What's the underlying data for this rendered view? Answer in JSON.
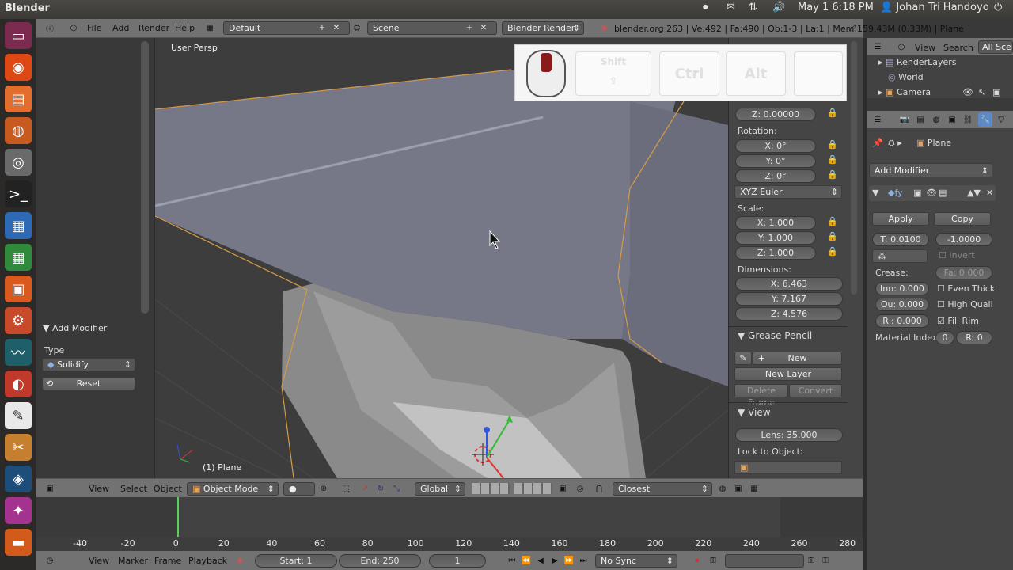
{
  "topbar": {
    "title": "Blender",
    "datetime": "May 1  6:18 PM",
    "user": "Johan Tri Handoyo"
  },
  "header": {
    "menus": [
      "File",
      "Add",
      "Render",
      "Help"
    ],
    "layout": "Default",
    "scene": "Scene",
    "engine": "Blender Render",
    "stats": "blender.org 263 | Ve:492 | Fa:490 | Ob:1-3 | La:1 | Mem:159.43M (0.33M) | Plane"
  },
  "keys": {
    "shift": "Shift",
    "ctrl": "Ctrl",
    "alt": "Alt"
  },
  "viewport": {
    "label": "User Persp",
    "object": "(1) Plane"
  },
  "toolshelf": {
    "title": "Add Modifier",
    "type_label": "Type",
    "type_value": "Solidify",
    "reset": "Reset"
  },
  "npanel": {
    "loc_z": "Z: 0.00000",
    "rotation_label": "Rotation:",
    "rot_x": "X: 0°",
    "rot_y": "Y: 0°",
    "rot_z": "Z: 0°",
    "rot_mode": "XYZ Euler",
    "scale_label": "Scale:",
    "sc_x": "X: 1.000",
    "sc_y": "Y: 1.000",
    "sc_z": "Z: 1.000",
    "dim_label": "Dimensions:",
    "dim_x": "X: 6.463",
    "dim_y": "Y: 7.167",
    "dim_z": "Z: 4.576",
    "grease_title": "Grease Pencil",
    "new": "New",
    "new_layer": "New Layer",
    "delete_frame": "Delete Frame",
    "convert": "Convert",
    "view_title": "View",
    "lens": "Lens: 35.000",
    "lock_label": "Lock to Object:"
  },
  "outliner": {
    "menus": [
      "View",
      "Search"
    ],
    "filter": "All Scene",
    "items": [
      "RenderLayers",
      "World",
      "Camera"
    ]
  },
  "props": {
    "object": "Plane",
    "add_modifier": "Add Modifier",
    "apply": "Apply",
    "copy": "Copy",
    "thickness": "T: 0.0100",
    "offset": "-1.0000",
    "invert": "Invert",
    "crease_label": "Crease:",
    "crease_fa": "Fa: 0.000",
    "inner": "Inn: 0.000",
    "outer": "Ou: 0.000",
    "rim": "Ri: 0.000",
    "even_thick": "Even Thick",
    "high_quality": "High Quali",
    "fill_rim": "Fill Rim",
    "material_label": "Material Index",
    "mat_a": "0",
    "mat_b": "R: 0"
  },
  "v3dheader": {
    "menus": [
      "View",
      "Select",
      "Object"
    ],
    "mode": "Object Mode",
    "orientation": "Global",
    "snap": "Closest"
  },
  "timeline": {
    "ticks": [
      -40,
      -20,
      0,
      20,
      40,
      60,
      80,
      100,
      120,
      140,
      160,
      180,
      200,
      220,
      240,
      260,
      280
    ],
    "current_frame": 1,
    "start": "Start: 1",
    "end": "End: 250",
    "frame": "1",
    "menus": [
      "View",
      "Marker",
      "Frame",
      "Playback"
    ],
    "sync": "No Sync"
  }
}
